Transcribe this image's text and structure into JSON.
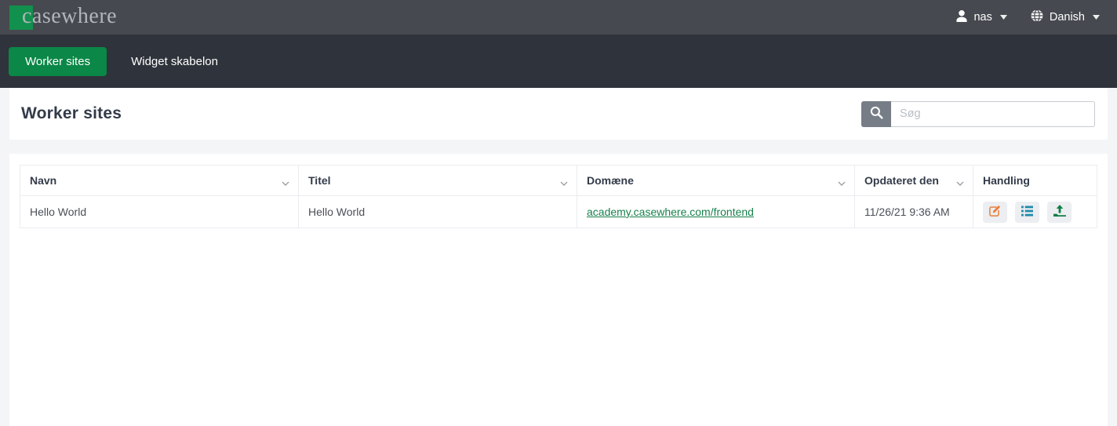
{
  "brand": {
    "logo_text": "casewhere"
  },
  "topbar": {
    "user_label": "nas",
    "language_label": "Danish"
  },
  "nav": {
    "tabs": [
      {
        "label": "Worker sites",
        "active": true
      },
      {
        "label": "Widget skabelon",
        "active": false
      }
    ]
  },
  "page": {
    "title": "Worker sites"
  },
  "search": {
    "placeholder": "Søg",
    "value": ""
  },
  "table": {
    "columns": [
      {
        "label": "Navn",
        "sortable": true
      },
      {
        "label": "Titel",
        "sortable": true
      },
      {
        "label": "Domæne",
        "sortable": true
      },
      {
        "label": "Opdateret den",
        "sortable": true
      },
      {
        "label": "Handling",
        "sortable": false
      }
    ],
    "rows": [
      {
        "navn": "Hello World",
        "titel": "Hello World",
        "domain": "academy.casewhere.com/frontend",
        "updated": "11/26/21 9:36 AM"
      }
    ],
    "action_icons": [
      "edit",
      "list",
      "upload"
    ]
  },
  "colors": {
    "brand_green": "#12904e",
    "active_tab_green": "#0b8747",
    "topbar_bg": "#46494f",
    "nav_bg": "#2f333b",
    "link_green": "#18804c",
    "edit_icon_orange": "#e87f3a",
    "list_icon_blue": "#2189ab",
    "upload_icon_green": "#0f7f45",
    "search_button_gray": "#767d87"
  }
}
